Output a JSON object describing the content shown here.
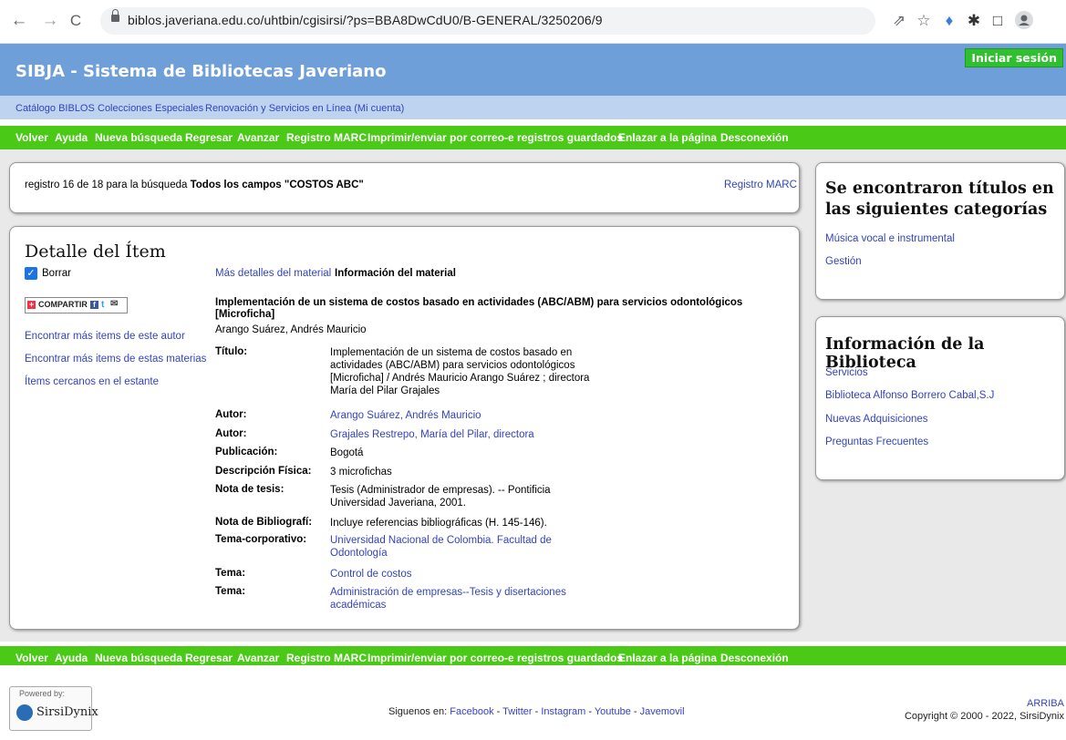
{
  "browser": {
    "url": "biblos.javeriana.edu.co/uhtbin/cgisirsi/?ps=BBA8DwCdU0/B-GENERAL/3250206/9",
    "back": "←",
    "forward": "→",
    "reload": "C"
  },
  "header": {
    "title": "SIBJA - Sistema de Bibliotecas Javeriano",
    "login": "Iniciar sesión"
  },
  "subnav": {
    "items": [
      "Catálogo BIBLOS",
      "Colecciones Especiales",
      "Renovación y Servicios en Línea (Mi cuenta)"
    ]
  },
  "toolbar": {
    "items": [
      "Volver",
      "Ayuda",
      "Nueva búsqueda",
      "Regresar",
      "Avanzar",
      "Registro MARC",
      "Imprimir/enviar por correo-e registros guardados",
      "Enlazar a la página",
      "Desconexión"
    ]
  },
  "record": {
    "prefix": "registro 16 de 18 para la búsqueda",
    "query": "Todos los campos \"COSTOS ABC\"",
    "marc_link": "Registro MARC"
  },
  "detail": {
    "heading": "Detalle del Ítem",
    "borrar": "Borrar",
    "share": "COMPARTIR",
    "left_links": [
      "Encontrar más items de este autor",
      "Encontrar más items de estas materias",
      "Ítems cercanos en el estante"
    ],
    "tab_more": "Más detalles del material",
    "tab_info": "Información del material",
    "main_title": "Implementación de un sistema de costos basado en actividades (ABC/ABM) para servicios odontológicos [Microficha]",
    "main_author": "Arango Suárez, Andrés Mauricio",
    "fields": [
      {
        "label": "Título:",
        "value": "Implementación de un sistema de costos basado en actividades (ABC/ABM) para servicios odontológicos [Microficha] / Andrés Mauricio Arango Suárez ; directora María del Pilar Grajales",
        "link": false
      },
      {
        "label": "Autor:",
        "value": "Arango Suárez, Andrés Mauricio",
        "link": true
      },
      {
        "label": "Autor:",
        "value": "Grajales Restrepo, María del Pilar, directora",
        "link": true
      },
      {
        "label": "Publicación:",
        "value": "Bogotá",
        "link": false
      },
      {
        "label": "Descripción Física:",
        "value": "3 microfichas",
        "link": false
      },
      {
        "label": "Nota de tesis:",
        "value": "Tesis (Administrador de empresas). -- Pontificia Universidad Javeriana, 2001.",
        "link": false
      },
      {
        "label": "Nota de Bibliografí:",
        "value": "Incluye referencias bibliográficas (H. 145-146).",
        "link": false
      },
      {
        "label": "Tema-corporativo:",
        "value": "Universidad Nacional de Colombia. Facultad de Odontología",
        "link": true
      },
      {
        "label": "Tema:",
        "value": "Control de costos",
        "link": true
      },
      {
        "label": "Tema:",
        "value": "Administración de empresas--Tesis y disertaciones académicas",
        "link": true
      }
    ]
  },
  "categories": {
    "heading": "Se encontraron títulos en las siguientes categorías",
    "items": [
      "Música vocal e instrumental",
      "Gestión"
    ]
  },
  "library": {
    "heading": "Información de la Biblioteca",
    "items": [
      "Servicios",
      "Biblioteca Alfonso Borrero Cabal,S.J",
      "Nuevas Adquisiciones",
      "Preguntas Frecuentes"
    ]
  },
  "footer": {
    "powered_by": "Powered by:",
    "brand": "SirsiDynix",
    "follow": "Siguenos en:",
    "social": [
      "Facebook",
      "Twitter",
      "Instagram",
      "Youtube",
      "Javemovil"
    ],
    "arriba": "ARRIBA",
    "copyright": "Copyright © 2000 - 2022, SirsiDynix"
  }
}
